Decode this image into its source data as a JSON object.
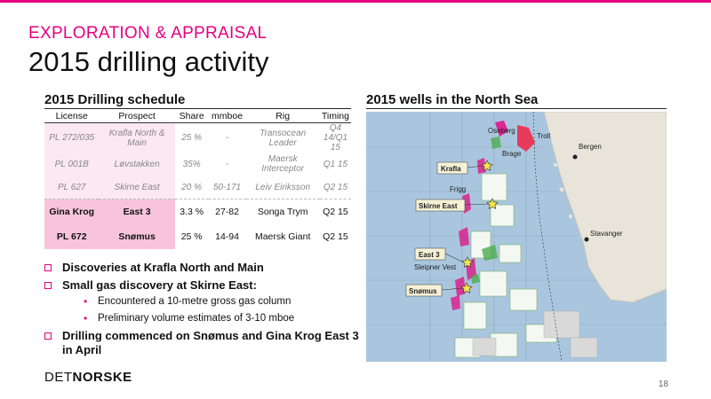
{
  "header": {
    "kicker": "EXPLORATION & APPRAISAL",
    "title": "2015 drilling activity"
  },
  "schedule": {
    "title": "2015 Drilling schedule",
    "columns": [
      "License",
      "Prospect",
      "Share",
      "mmboe",
      "Rig",
      "Timing"
    ],
    "rows": [
      {
        "license": "PL 272/035",
        "prospect": "Krafla North & Main",
        "share": "25 %",
        "mmboe": "-",
        "rig": "Transocean Leader",
        "timing": "Q4 14/Q1 15"
      },
      {
        "license": "PL 001B",
        "prospect": "Løvstakken",
        "share": "35%",
        "mmboe": "-",
        "rig": "Maersk Interceptor",
        "timing": "Q1 15"
      },
      {
        "license": "PL 627",
        "prospect": "Skirne East",
        "share": "20 %",
        "mmboe": "50-171",
        "rig": "Leiv Eiriksson",
        "timing": "Q2 15"
      },
      {
        "license": "Gina Krog",
        "prospect": "East 3",
        "share": "3.3 %",
        "mmboe": "27-82",
        "rig": "Songa Trym",
        "timing": "Q2 15"
      },
      {
        "license": "PL 672",
        "prospect": "Snømus",
        "share": "25 %",
        "mmboe": "14-94",
        "rig": "Maersk Giant",
        "timing": "Q2 15"
      }
    ]
  },
  "bullets": {
    "b1": "Discoveries at Krafla North and Main",
    "b2": "Small gas discovery at Skirne East:",
    "b2_sub1": "Encountered a 10-metre gross gas column",
    "b2_sub2": "Preliminary volume estimates of 3-10 mboe",
    "b3": "Drilling commenced on Snømus and Gina Krog East 3 in April"
  },
  "map": {
    "title": "2015 wells in the North Sea",
    "labels": {
      "oseberg": "Oseberg",
      "troll": "Troll",
      "brage": "Brage",
      "bergen": "Bergen",
      "krafla": "Krafla",
      "frigg": "Frigg",
      "skirne": "Skirne East",
      "stavanger": "Stavanger",
      "east3": "East 3",
      "sleipner": "Sleipner Vest",
      "snomus": "Snømus"
    }
  },
  "footer": {
    "logo_light": "DET",
    "logo_bold": "NORSKE",
    "page": "18"
  },
  "colors": {
    "accent": "#e6007e",
    "sea": "#a9c6de",
    "land": "#e8e4da"
  }
}
